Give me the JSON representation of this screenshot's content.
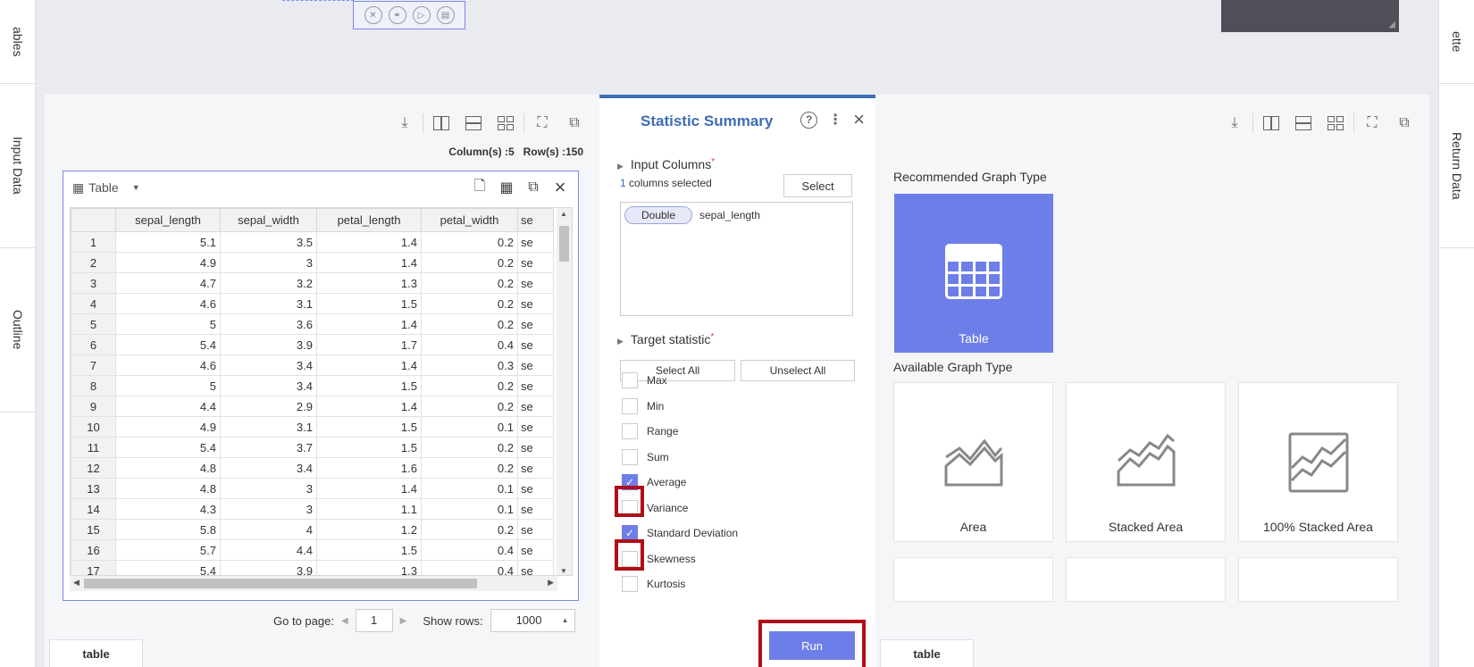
{
  "side_left": {
    "tabs": [
      "ables",
      "Input Data",
      "Outline"
    ]
  },
  "side_right": {
    "tabs": [
      "ette",
      "Return Data"
    ]
  },
  "left_panel": {
    "col_info": "Column(s) :5",
    "row_info": "Row(s) :150",
    "card_title": "Table",
    "columns": [
      "",
      "sepal_length",
      "sepal_width",
      "petal_length",
      "petal_width",
      "se"
    ],
    "rows": [
      [
        "1",
        "5.1",
        "3.5",
        "1.4",
        "0.2",
        "se"
      ],
      [
        "2",
        "4.9",
        "3",
        "1.4",
        "0.2",
        "se"
      ],
      [
        "3",
        "4.7",
        "3.2",
        "1.3",
        "0.2",
        "se"
      ],
      [
        "4",
        "4.6",
        "3.1",
        "1.5",
        "0.2",
        "se"
      ],
      [
        "5",
        "5",
        "3.6",
        "1.4",
        "0.2",
        "se"
      ],
      [
        "6",
        "5.4",
        "3.9",
        "1.7",
        "0.4",
        "se"
      ],
      [
        "7",
        "4.6",
        "3.4",
        "1.4",
        "0.3",
        "se"
      ],
      [
        "8",
        "5",
        "3.4",
        "1.5",
        "0.2",
        "se"
      ],
      [
        "9",
        "4.4",
        "2.9",
        "1.4",
        "0.2",
        "se"
      ],
      [
        "10",
        "4.9",
        "3.1",
        "1.5",
        "0.1",
        "se"
      ],
      [
        "11",
        "5.4",
        "3.7",
        "1.5",
        "0.2",
        "se"
      ],
      [
        "12",
        "4.8",
        "3.4",
        "1.6",
        "0.2",
        "se"
      ],
      [
        "13",
        "4.8",
        "3",
        "1.4",
        "0.1",
        "se"
      ],
      [
        "14",
        "4.3",
        "3",
        "1.1",
        "0.1",
        "se"
      ],
      [
        "15",
        "5.8",
        "4",
        "1.2",
        "0.2",
        "se"
      ],
      [
        "16",
        "5.7",
        "4.4",
        "1.5",
        "0.4",
        "se"
      ],
      [
        "17",
        "5.4",
        "3.9",
        "1.3",
        "0.4",
        "se"
      ]
    ],
    "pager": {
      "goto_label": "Go to page:",
      "page": "1",
      "show_rows_label": "Show rows:",
      "rows_value": "1000"
    },
    "bottom_tab": "table"
  },
  "mid_panel": {
    "title": "Statistic Summary",
    "input_columns_label": "Input Columns",
    "required_mark": "*",
    "selected_count": "1",
    "selected_suffix": "columns selected",
    "select_button": "Select",
    "chip_type": "Double",
    "chip_name": "sepal_length",
    "target_label": "Target statistic",
    "select_all": "Select All",
    "unselect_all": "Unselect All",
    "stats": [
      {
        "label": "Max",
        "checked": false
      },
      {
        "label": "Min",
        "checked": false
      },
      {
        "label": "Range",
        "checked": false
      },
      {
        "label": "Sum",
        "checked": false
      },
      {
        "label": "Average",
        "checked": true
      },
      {
        "label": "Variance",
        "checked": false
      },
      {
        "label": "Standard Deviation",
        "checked": true
      },
      {
        "label": "Skewness",
        "checked": false
      },
      {
        "label": "Kurtosis",
        "checked": false
      }
    ],
    "run_button": "Run"
  },
  "right_panel": {
    "recommended_label": "Recommended Graph Type",
    "recommended_tile": "Table",
    "available_label": "Available Graph Type",
    "tiles": [
      "Area",
      "Stacked Area",
      "100% Stacked Area"
    ],
    "bottom_tab": "table"
  },
  "colors": {
    "accent": "#6e7ee8",
    "title_blue": "#3d6db3",
    "highlight": "#b00e16"
  }
}
